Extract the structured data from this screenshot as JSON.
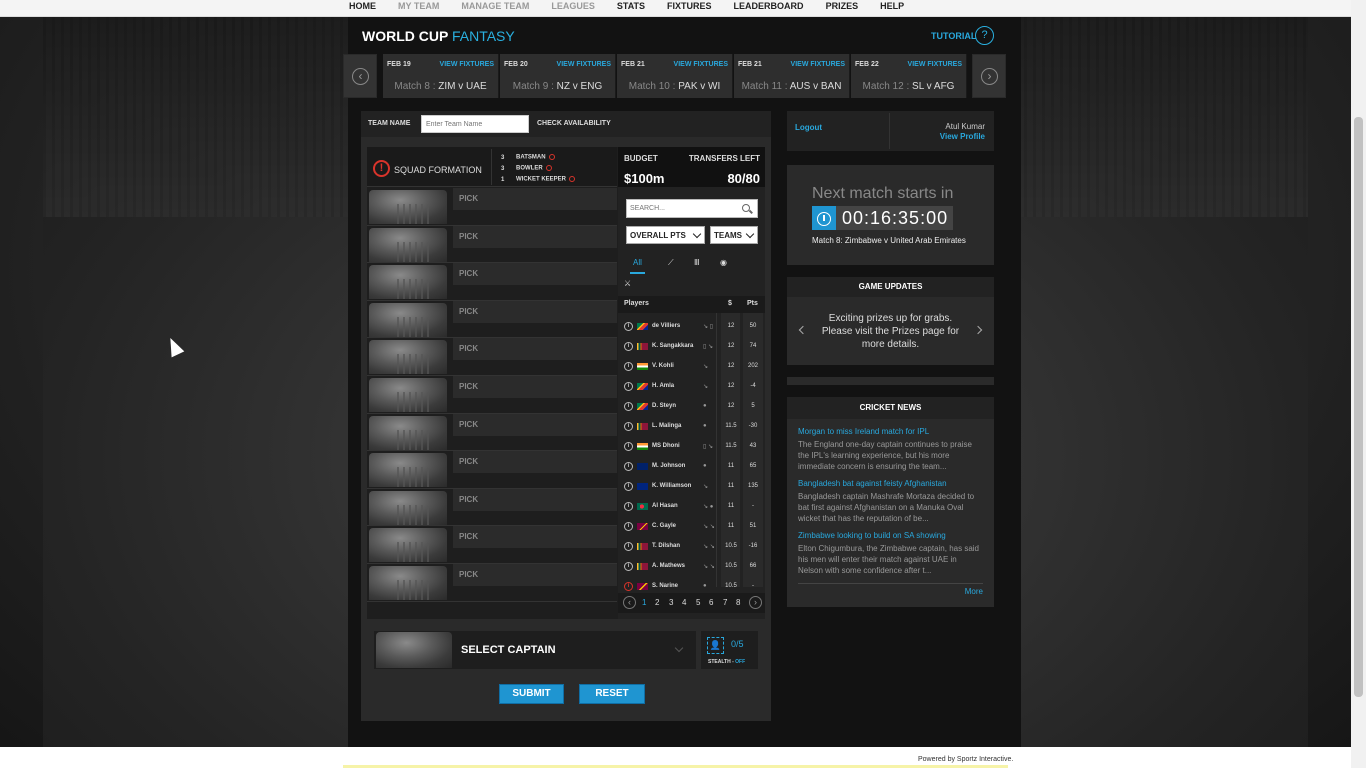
{
  "nav": [
    "HOME",
    "MY TEAM",
    "MANAGE TEAM",
    "LEAGUES",
    "STATS",
    "FIXTURES",
    "LEADERBOARD",
    "PRIZES",
    "HELP"
  ],
  "brand": {
    "main": "WORLD CUP",
    "accent": "FANTASY"
  },
  "tutorial": "TUTORIAL",
  "fixtures": [
    {
      "date": "FEB 19",
      "view": "VIEW FIXTURES",
      "match": "Match 8",
      "teams": "ZIM v UAE"
    },
    {
      "date": "FEB 20",
      "view": "VIEW FIXTURES",
      "match": "Match 9",
      "teams": "NZ v ENG"
    },
    {
      "date": "FEB 21",
      "view": "VIEW FIXTURES",
      "match": "Match 10",
      "teams": "PAK v WI"
    },
    {
      "date": "FEB 21",
      "view": "VIEW FIXTURES",
      "match": "Match 11",
      "teams": "AUS v BAN"
    },
    {
      "date": "FEB 22",
      "view": "VIEW FIXTURES",
      "match": "Match 12",
      "teams": "SL v AFG"
    }
  ],
  "team": {
    "label": "TEAM NAME",
    "placeholder": "Enter Team Name",
    "check": "CHECK AVAILABILITY"
  },
  "formation": {
    "title": "SQUAD FORMATION",
    "reqs": [
      {
        "n": "3",
        "role": "BATSMAN"
      },
      {
        "n": "3",
        "role": "BOWLER"
      },
      {
        "n": "1",
        "role": "WICKET KEEPER"
      }
    ]
  },
  "pick_label": "PICK",
  "budget": {
    "label": "BUDGET",
    "value": "$100m",
    "transfers_label": "TRANSFERS LEFT",
    "transfers": "80/80"
  },
  "search_placeholder": "SEARCH...",
  "sort_select": "OVERALL PTS",
  "teams_select": "TEAMS",
  "filter_all": "All",
  "table_head": {
    "players": "Players",
    "cost": "$",
    "pts": "Pts"
  },
  "players": [
    {
      "name": "de Villiers",
      "flag": "sa",
      "cost": "12",
      "pts": "50",
      "sk": "↘ ▯"
    },
    {
      "name": "K. Sangakkara",
      "flag": "sl",
      "cost": "12",
      "pts": "74",
      "sk": "▯ ↘"
    },
    {
      "name": "V. Kohli",
      "flag": "ind",
      "cost": "12",
      "pts": "202",
      "sk": "↘"
    },
    {
      "name": "H. Amla",
      "flag": "sa",
      "cost": "12",
      "pts": "-4",
      "sk": "↘"
    },
    {
      "name": "D. Steyn",
      "flag": "sa",
      "cost": "12",
      "pts": "5",
      "sk": "●"
    },
    {
      "name": "L. Malinga",
      "flag": "sl",
      "cost": "11.5",
      "pts": "-30",
      "sk": "●"
    },
    {
      "name": "MS Dhoni",
      "flag": "ind",
      "cost": "11.5",
      "pts": "43",
      "sk": "▯ ↘"
    },
    {
      "name": "M. Johnson",
      "flag": "aus",
      "cost": "11",
      "pts": "65",
      "sk": "●"
    },
    {
      "name": "K. Williamson",
      "flag": "nz",
      "cost": "11",
      "pts": "135",
      "sk": "↘"
    },
    {
      "name": "Al Hasan",
      "flag": "ban",
      "cost": "11",
      "pts": "-",
      "sk": "↘ ●"
    },
    {
      "name": "C. Gayle",
      "flag": "wi",
      "cost": "11",
      "pts": "51",
      "sk": "↘ ↘"
    },
    {
      "name": "T. Dilshan",
      "flag": "sl",
      "cost": "10.5",
      "pts": "-16",
      "sk": "↘ ↘"
    },
    {
      "name": "A. Mathews",
      "flag": "sl",
      "cost": "10.5",
      "pts": "66",
      "sk": "↘ ↘"
    },
    {
      "name": "S. Narine",
      "flag": "wi",
      "cost": "10.5",
      "pts": "-",
      "sk": "●",
      "warn": true
    }
  ],
  "pages": [
    "1",
    "2",
    "3",
    "4",
    "5",
    "6",
    "7",
    "8"
  ],
  "captain": "SELECT CAPTAIN",
  "stealth": {
    "count": "0/5",
    "label": "STEALTH",
    "state": "OFF"
  },
  "submit": "SUBMIT",
  "reset": "RESET",
  "user": {
    "logout": "Logout",
    "name": "Atul Kumar",
    "view": "View Profile"
  },
  "next": {
    "heading": "Next match starts in",
    "timer": "00:16:35:00",
    "match": "Match 8: Zimbabwe v United Arab Emirates"
  },
  "updates": {
    "title": "GAME UPDATES",
    "text": "Exciting prizes up for grabs. Please visit the Prizes page for more details."
  },
  "news": {
    "title": "CRICKET NEWS",
    "items": [
      {
        "title": "Morgan to miss Ireland match for IPL",
        "desc": "The England one-day captain continues to praise the IPL's learning experience, but his more immediate concern is ensuring the team..."
      },
      {
        "title": "Bangladesh bat against feisty Afghanistan",
        "desc": "Bangladesh captain Mashrafe Mortaza decided to bat first against Afghanistan on a Manuka Oval wicket that has the reputation of be..."
      },
      {
        "title": "Zimbabwe looking to build on SA showing",
        "desc": "Elton Chigumbura, the Zimbabwe captain, has said his men will enter their match against UAE in Nelson with some confidence after t..."
      }
    ],
    "more": "More"
  },
  "footer": "Powered by Sportz Interactive."
}
